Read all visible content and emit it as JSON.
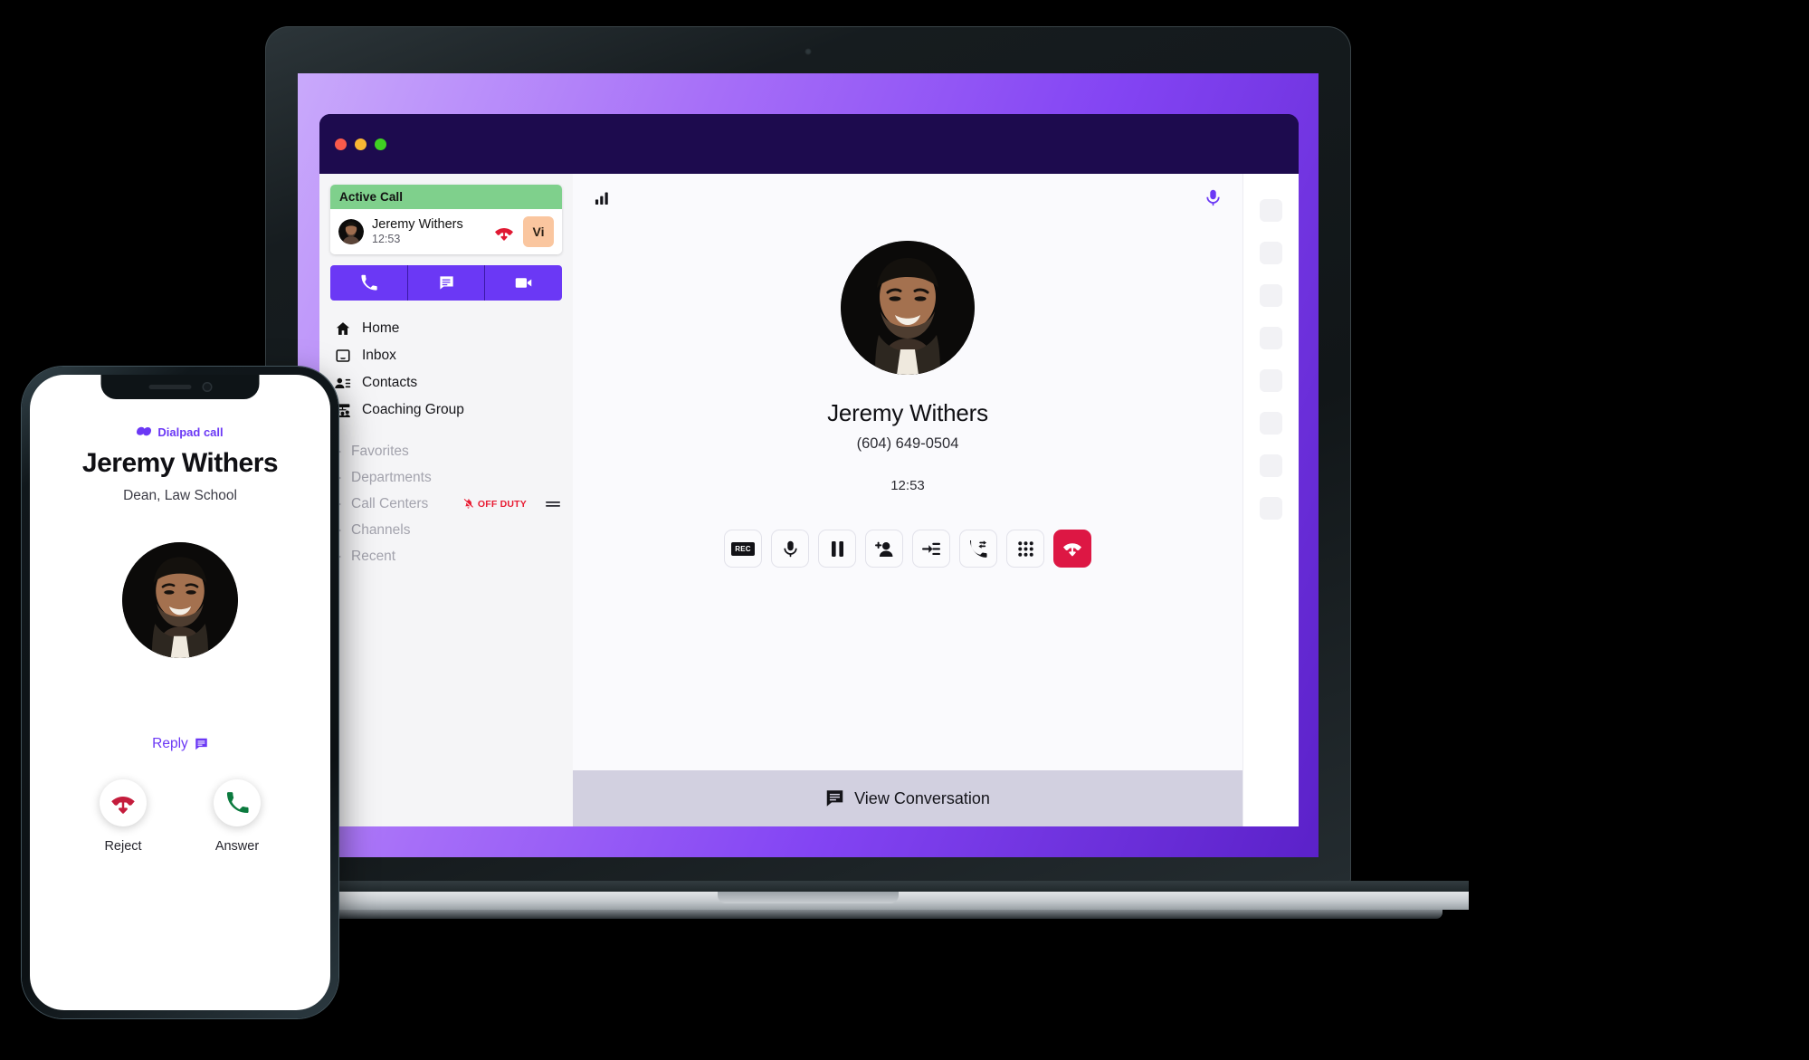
{
  "window": {
    "traffic_lights": [
      "close",
      "minimize",
      "maximize"
    ],
    "title_bar_color": "#1d0b4e"
  },
  "colors": {
    "brand_purple": "#6b38f5",
    "active_call_green": "#7fd08c",
    "badge_peach": "#fac69f",
    "hangup_red": "#dd1744",
    "off_duty_red": "#e81b32",
    "answer_green": "#0b7a3e",
    "conversation_bar": "#d2d0e0"
  },
  "sidebar": {
    "active_call": {
      "header_label": "Active Call",
      "contact_name": "Jeremy Withers",
      "duration": "12:53",
      "hangup_icon": "hangup-icon",
      "badge_label": "Vi",
      "avatar_icon": "avatar"
    },
    "quick_actions": [
      {
        "name": "call",
        "icon": "phone-icon"
      },
      {
        "name": "message",
        "icon": "chat-icon"
      },
      {
        "name": "video",
        "icon": "video-camera-icon"
      }
    ],
    "nav_items": [
      {
        "label": "Home",
        "icon": "home-icon"
      },
      {
        "label": "Inbox",
        "icon": "inbox-icon"
      },
      {
        "label": "Contacts",
        "icon": "contacts-icon"
      },
      {
        "label": "Coaching Group",
        "icon": "coaching-group-icon"
      }
    ],
    "groups": [
      {
        "label": "Favorites",
        "badge": null
      },
      {
        "label": "Departments",
        "badge": null
      },
      {
        "label": "Call Centers",
        "badge": "OFF DUTY"
      },
      {
        "label": "Channels",
        "badge": null
      },
      {
        "label": "Recent",
        "badge": null
      }
    ]
  },
  "main": {
    "signal_icon": "signal-bars-icon",
    "mic_icon": "microphone-icon",
    "caller_name": "Jeremy Withers",
    "caller_number": "(604) 649-0504",
    "call_duration": "12:53",
    "controls": [
      {
        "name": "record",
        "icon": "rec-icon",
        "label": "REC"
      },
      {
        "name": "mute",
        "icon": "microphone-icon"
      },
      {
        "name": "hold",
        "icon": "pause-icon"
      },
      {
        "name": "add-participant",
        "icon": "add-person-icon"
      },
      {
        "name": "transfer",
        "icon": "transfer-icon"
      },
      {
        "name": "move-call",
        "icon": "call-move-icon"
      },
      {
        "name": "keypad",
        "icon": "keypad-icon"
      },
      {
        "name": "hangup",
        "icon": "hangup-icon"
      }
    ],
    "conversation_bar": {
      "label": "View Conversation",
      "icon": "chat-icon"
    }
  },
  "right_rail": {
    "slot_count": 8
  },
  "phone": {
    "brand_label": "Dialpad call",
    "brand_icon": "dialpad-logo-icon",
    "caller_name": "Jeremy Withers",
    "caller_title": "Dean, Law School",
    "reply": {
      "label": "Reply",
      "icon": "chat-icon"
    },
    "actions": [
      {
        "label": "Reject",
        "icon": "hangup-icon"
      },
      {
        "label": "Answer",
        "icon": "phone-icon"
      }
    ]
  }
}
